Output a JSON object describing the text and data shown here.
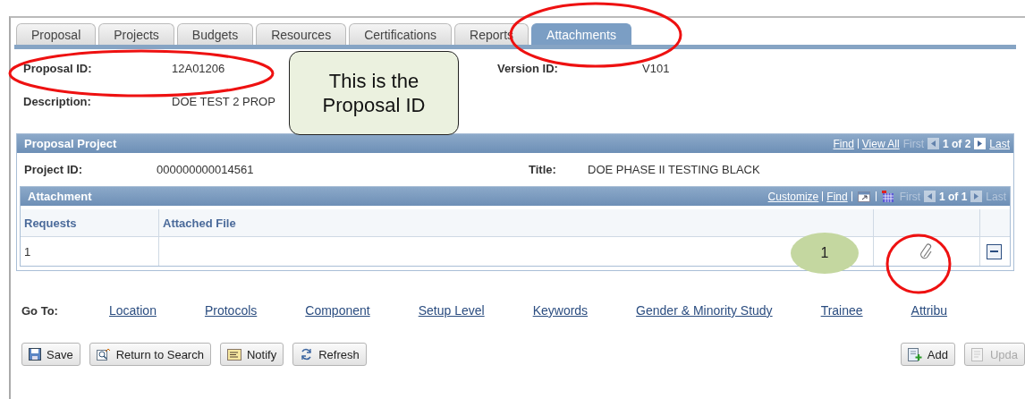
{
  "tabs": [
    {
      "label": "Proposal",
      "selected": false
    },
    {
      "label": "Projects",
      "selected": false
    },
    {
      "label": "Budgets",
      "selected": false
    },
    {
      "label": "Resources",
      "selected": false
    },
    {
      "label": "Certifications",
      "selected": false
    },
    {
      "label": "Reports",
      "selected": false
    },
    {
      "label": "Attachments",
      "selected": true
    }
  ],
  "header": {
    "proposal_id_label": "Proposal ID:",
    "proposal_id": "12A01206",
    "version_label": "Version ID:",
    "version": "V101",
    "description_label": "Description:",
    "description": "DOE TEST 2 PROP"
  },
  "callout": {
    "text": "This is the Proposal ID"
  },
  "project_panel": {
    "title": "Proposal Project",
    "nav": {
      "links": [
        "Find",
        "View All"
      ],
      "first": {
        "label": "First",
        "disabled": true
      },
      "count": "1 of 2",
      "last": {
        "label": "Last",
        "disabled": false
      }
    },
    "project_id_label": "Project ID:",
    "project_id": "000000000014561",
    "title_label": "Title:",
    "title_value": "DOE PHASE II TESTING BLACK"
  },
  "attachment_grid": {
    "title": "Attachment",
    "nav": {
      "links": [
        "Customize",
        "Find"
      ],
      "first": {
        "label": "First",
        "disabled": true
      },
      "count": "1 of 1",
      "last": {
        "label": "Last",
        "disabled": true
      }
    },
    "columns": [
      "Requests",
      "Attached File"
    ],
    "rows": [
      {
        "requests": "1",
        "attached_file": ""
      }
    ]
  },
  "step_badge": {
    "text": "1"
  },
  "goto": {
    "label": "Go To:",
    "links": [
      "Location",
      "Protocols",
      "Component",
      "Setup Level",
      "Keywords",
      "Gender & Minority Study",
      "Trainee",
      "Attribu"
    ]
  },
  "buttons_left": [
    {
      "kind": "save",
      "label": "Save",
      "disabled": false
    },
    {
      "kind": "search",
      "label": "Return to Search",
      "disabled": false
    },
    {
      "kind": "notify",
      "label": "Notify",
      "disabled": false
    },
    {
      "kind": "refresh",
      "label": "Refresh",
      "disabled": false
    }
  ],
  "buttons_right": [
    {
      "kind": "add",
      "label": "Add",
      "disabled": false
    },
    {
      "kind": "update",
      "label": "Upda",
      "disabled": true
    }
  ]
}
